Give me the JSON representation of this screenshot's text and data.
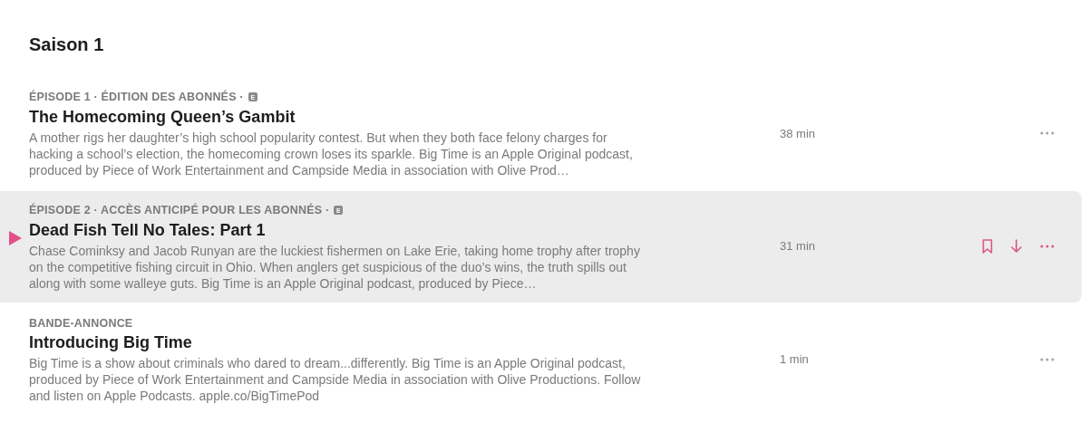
{
  "season_title": "Saison 1",
  "episodes": [
    {
      "label": "ÉPISODE 1 · ÉDITION DES ABONNÉS ·",
      "explicit_badge": "E",
      "title": "The Homecoming Queen’s Gambit",
      "description": "A mother rigs her daughter’s high school popularity contest. But when they both face felony charges for hacking a school’s election, the homecoming crown loses its sparkle. Big Time is an Apple Original podcast, produced by Piece of Work Entertainment and Campside Media in association with Olive Prod…",
      "duration": "38 min",
      "hovered": false
    },
    {
      "label": "ÉPISODE 2 · ACCÈS ANTICIPÉ POUR LES ABONNÉS ·",
      "explicit_badge": "E",
      "title": "Dead Fish Tell No Tales: Part 1",
      "description": "Chase Cominksy and Jacob Runyan are the luckiest fishermen on Lake Erie, taking home trophy after trophy on the competitive fishing circuit in Ohio. When anglers get suspicious of the duo’s wins, the truth spills out along with some walleye guts. Big Time is an Apple Original podcast, produced by Piece…",
      "duration": "31 min",
      "hovered": true
    },
    {
      "label": "BANDE-ANNONCE",
      "title": "Introducing Big Time",
      "description": "Big Time is a show about criminals who dared to dream...differently. Big Time is an Apple Original podcast, produced by Piece of Work Entertainment and Campside Media in association with Olive Productions. Follow and listen on Apple Podcasts. apple.co/BigTimePod",
      "duration": "1 min",
      "hovered": false
    }
  ]
}
